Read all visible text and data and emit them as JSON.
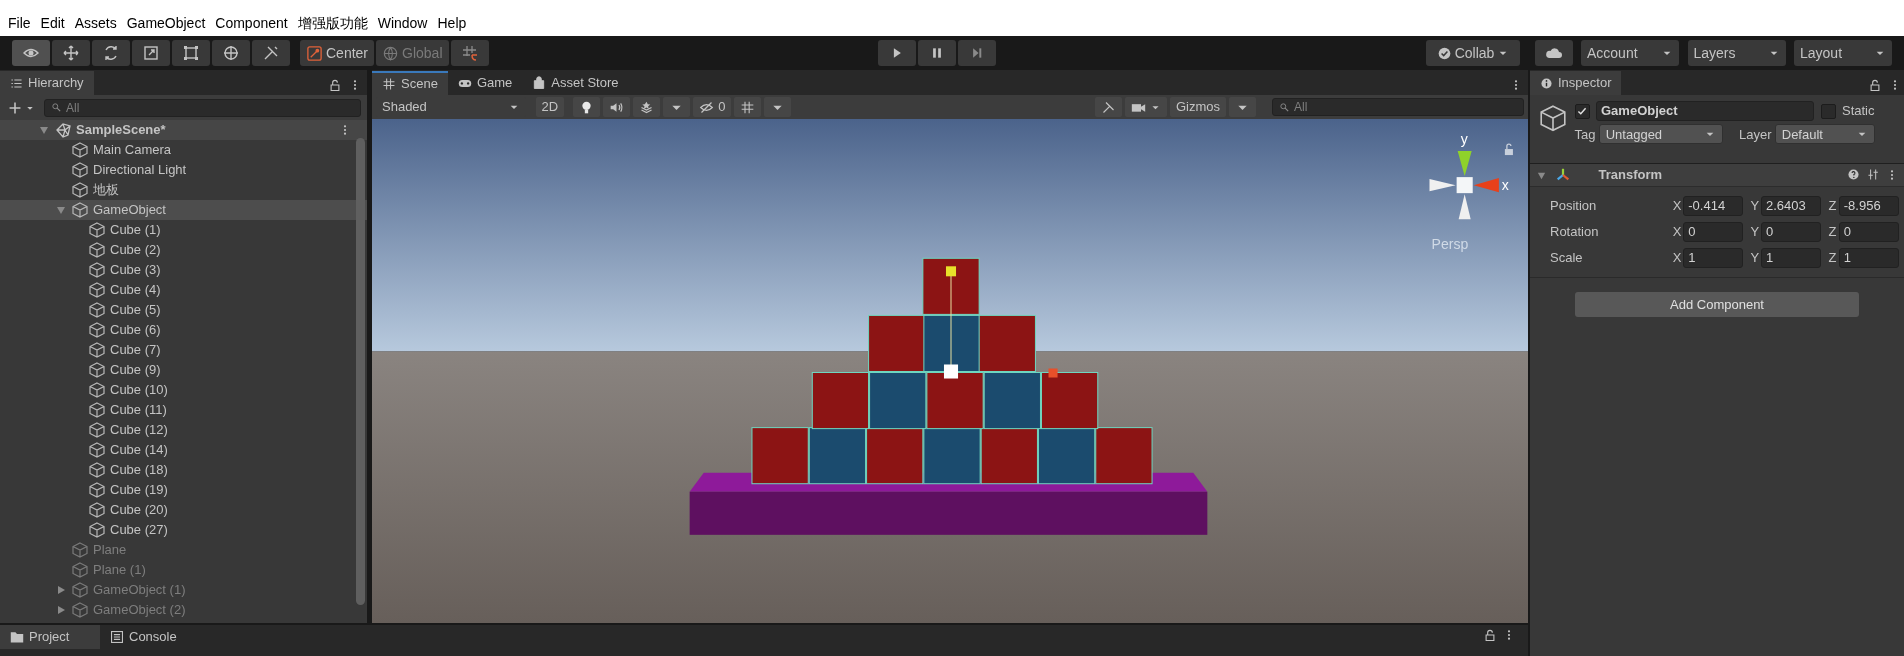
{
  "menu": [
    "File",
    "Edit",
    "Assets",
    "GameObject",
    "Component",
    "增强版功能",
    "Window",
    "Help"
  ],
  "toolbar": {
    "tools": [
      {
        "kind": "view",
        "selected": true
      },
      {
        "kind": "move",
        "selected": false
      },
      {
        "kind": "rotate",
        "selected": false
      },
      {
        "kind": "scale",
        "selected": false
      },
      {
        "kind": "rect",
        "selected": false
      },
      {
        "kind": "transform",
        "selected": false
      },
      {
        "kind": "custom",
        "selected": false
      }
    ],
    "pivot": [
      {
        "label": "Center",
        "kind": "center",
        "disabled": false
      },
      {
        "label": "Global",
        "kind": "global",
        "disabled": true
      }
    ],
    "playback": [
      {
        "kind": "play"
      },
      {
        "kind": "pause"
      },
      {
        "kind": "step"
      }
    ],
    "collab": "Collab",
    "account": "Account",
    "layers": "Layers",
    "layout": "Layout"
  },
  "hierarchy": {
    "title": "Hierarchy",
    "search_placeholder": "All",
    "scene": {
      "name": "SampleScene*",
      "expanded": true,
      "children": [
        {
          "name": "Main Camera",
          "selected": false,
          "active": true
        },
        {
          "name": "Directional Light",
          "selected": false,
          "active": true
        },
        {
          "name": "地板",
          "selected": false,
          "active": true
        },
        {
          "name": "GameObject",
          "selected": true,
          "active": true,
          "expanded": true,
          "children": [
            {
              "name": "Cube (1)",
              "selected": false,
              "active": true
            },
            {
              "name": "Cube (2)",
              "selected": false,
              "active": true
            },
            {
              "name": "Cube (3)",
              "selected": false,
              "active": true
            },
            {
              "name": "Cube (4)",
              "selected": false,
              "active": true
            },
            {
              "name": "Cube (5)",
              "selected": false,
              "active": true
            },
            {
              "name": "Cube (6)",
              "selected": false,
              "active": true
            },
            {
              "name": "Cube (7)",
              "selected": false,
              "active": true
            },
            {
              "name": "Cube (9)",
              "selected": false,
              "active": true
            },
            {
              "name": "Cube (10)",
              "selected": false,
              "active": true
            },
            {
              "name": "Cube (11)",
              "selected": false,
              "active": true
            },
            {
              "name": "Cube (12)",
              "selected": false,
              "active": true
            },
            {
              "name": "Cube (14)",
              "selected": false,
              "active": true
            },
            {
              "name": "Cube (18)",
              "selected": false,
              "active": true
            },
            {
              "name": "Cube (19)",
              "selected": false,
              "active": true
            },
            {
              "name": "Cube (20)",
              "selected": false,
              "active": true
            },
            {
              "name": "Cube (27)",
              "selected": false,
              "active": true
            }
          ]
        },
        {
          "name": "Plane",
          "selected": false,
          "active": false
        },
        {
          "name": "Plane (1)",
          "selected": false,
          "active": false
        },
        {
          "name": "GameObject (1)",
          "selected": false,
          "active": false,
          "expanded": false
        },
        {
          "name": "GameObject (2)",
          "selected": false,
          "active": false,
          "expanded": false
        }
      ]
    }
  },
  "scene_panel": {
    "tabs": [
      {
        "label": "Scene",
        "kind": "scene",
        "selected": true
      },
      {
        "label": "Game",
        "kind": "game",
        "selected": false
      },
      {
        "label": "Asset Store",
        "kind": "store",
        "selected": false
      }
    ],
    "shading": "Shaded",
    "mode_2d": "2D",
    "hidden_count": "0",
    "gizmos": "Gizmos",
    "search_placeholder": "All",
    "gizmo_axes": [
      "y",
      "x"
    ],
    "projection": "Persp"
  },
  "inspector": {
    "title": "Inspector",
    "active": true,
    "object_name": "GameObject",
    "static": false,
    "static_label": "Static",
    "tag_label": "Tag",
    "tag": "Untagged",
    "layer_label": "Layer",
    "layer": "Default",
    "component": "Transform",
    "expanded": true,
    "rows": [
      {
        "label": "Position",
        "values": [
          {
            "axis": "X",
            "value": "-0.414"
          },
          {
            "axis": "Y",
            "value": "2.6403"
          },
          {
            "axis": "Z",
            "value": "-8.956"
          }
        ]
      },
      {
        "label": "Rotation",
        "values": [
          {
            "axis": "X",
            "value": "0"
          },
          {
            "axis": "Y",
            "value": "0"
          },
          {
            "axis": "Z",
            "value": "0"
          }
        ]
      },
      {
        "label": "Scale",
        "values": [
          {
            "axis": "X",
            "value": "1"
          },
          {
            "axis": "Y",
            "value": "1"
          },
          {
            "axis": "Z",
            "value": "1"
          }
        ]
      }
    ],
    "add_button": "Add Component"
  },
  "bottom_tabs": [
    {
      "label": "Project",
      "kind": "project",
      "selected": true
    },
    {
      "label": "Console",
      "kind": "console",
      "selected": false
    }
  ]
}
